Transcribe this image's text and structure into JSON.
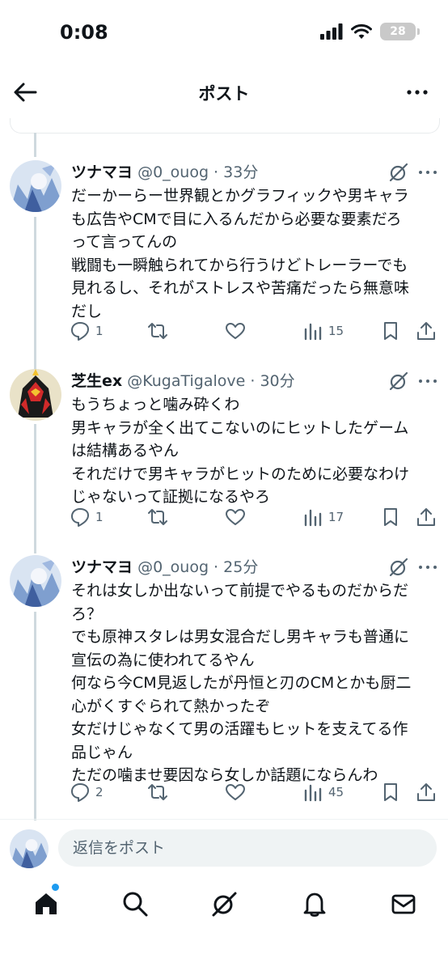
{
  "status": {
    "time": "0:08",
    "battery": "28"
  },
  "nav": {
    "title": "ポスト"
  },
  "tweets": [
    {
      "name": "ツナマヨ",
      "handle": "@0_ouog",
      "time": "33分",
      "lines": [
        "だーかーらー世界観とかグラフィックや男キャラ",
        "も広告やCMで目に入るんだから必要な要素だろ",
        "って言ってんの",
        "戦闘も一瞬触られてから行うけどトレーラーでも",
        "見れるし、それがストレスや苦痛だったら無意味",
        "だし"
      ],
      "replies": "1",
      "views": "15"
    },
    {
      "name": "芝生ex",
      "handle": "@KugaTigalove",
      "time": "30分",
      "lines": [
        "もうちょっと噛み砕くわ",
        "男キャラが全く出てこないのにヒットしたゲーム",
        "は結構あるやん",
        "それだけで男キャラがヒットのために必要なわけ",
        "じゃないって証拠になるやろ"
      ],
      "replies": "1",
      "views": "17"
    },
    {
      "name": "ツナマヨ",
      "handle": "@0_ouog",
      "time": "25分",
      "lines": [
        "それは女しか出ないって前提でやるものだからだ",
        "ろ？",
        "でも原神スタレは男女混合だし男キャラも普通に",
        "宣伝の為に使われてるやん",
        "何なら今CM見返したが丹恒と刃のCMとかも厨二",
        "心がくすぐられて熱かったぞ",
        "女だけじゃなくて男の活躍もヒットを支えてる作",
        "品じゃん",
        "ただの噛ませ要因なら女しか話題にならんわ"
      ],
      "replies": "2",
      "views": "45"
    }
  ],
  "reply": {
    "placeholder": "返信をポスト"
  },
  "colors": {
    "accent": "#1d9bf0",
    "text": "#0f1419",
    "secondary": "#536471"
  }
}
